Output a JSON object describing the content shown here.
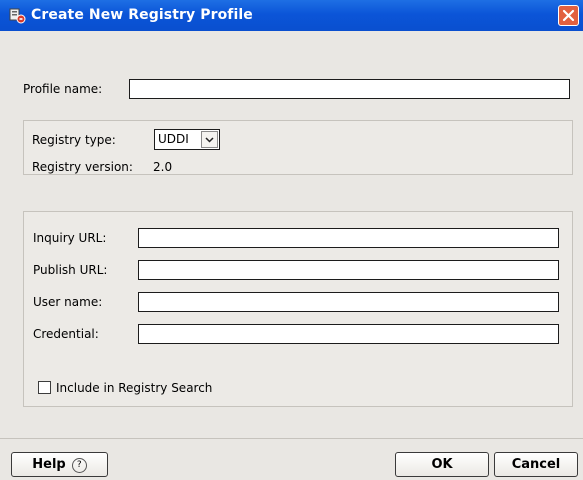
{
  "window": {
    "title": "Create New Registry Profile",
    "title_icon": "registry-profile-icon",
    "close_icon": "close-icon",
    "accent": "#0b55d8"
  },
  "profile": {
    "label": "Profile name:",
    "value": ""
  },
  "registry": {
    "type_label": "Registry type:",
    "type_value": "UDDI",
    "version_label": "Registry version:",
    "version_value": "2.0"
  },
  "connection": {
    "inquiry_label": "Inquiry URL:",
    "inquiry_value": "",
    "publish_label": "Publish URL:",
    "publish_value": "",
    "user_label": "User name:",
    "user_value": "",
    "credential_label": "Credential:",
    "credential_value": "",
    "search_checkbox_label": "Include in Registry Search"
  },
  "buttons": {
    "help": "Help",
    "help_icon_glyph": "?",
    "ok": "OK",
    "cancel": "Cancel"
  }
}
